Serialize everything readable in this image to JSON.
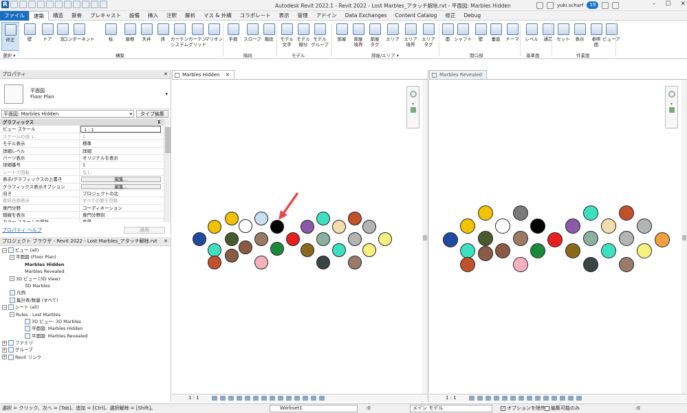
{
  "app": {
    "title": "Autodesk Revit 2022.1 - Revit 2022 - Lost Marbles_アタッチ解除.rvt - 平面図: Marbles Hidden",
    "user": "yuki.scharf",
    "notifications": "19",
    "window_controls": [
      "–",
      "☐",
      "✕"
    ]
  },
  "ribbon_tabs": [
    {
      "label": "ファイル",
      "kind": "file"
    },
    {
      "label": "建築",
      "kind": "active"
    },
    {
      "label": "構造"
    },
    {
      "label": "鉄骨"
    },
    {
      "label": "プレキャスト"
    },
    {
      "label": "設備"
    },
    {
      "label": "挿入"
    },
    {
      "label": "注釈"
    },
    {
      "label": "解析"
    },
    {
      "label": "マス & 外構"
    },
    {
      "label": "コラボレート"
    },
    {
      "label": "表示"
    },
    {
      "label": "管理"
    },
    {
      "label": "アドイン"
    },
    {
      "label": "Data Exchanges"
    },
    {
      "label": "Content Catalog"
    },
    {
      "label": "修正"
    },
    {
      "label": "Debug"
    }
  ],
  "ribbon_tools": [
    {
      "label": "修正",
      "icon": "cursor-icon",
      "selected": true
    },
    {
      "label": "壁",
      "icon": "wall-icon"
    },
    {
      "label": "ドア",
      "icon": "door-icon"
    },
    {
      "label": "窓",
      "icon": "window-icon"
    },
    {
      "label": "コンポーネント",
      "icon": "component-icon"
    },
    {
      "label": "柱",
      "icon": "column-icon"
    },
    {
      "label": "屋根",
      "icon": "roof-icon"
    },
    {
      "label": "天井",
      "icon": "ceiling-icon"
    },
    {
      "label": "床",
      "icon": "floor-icon"
    },
    {
      "label": "カーテン\nシステム",
      "icon": "curtain-system-icon"
    },
    {
      "label": "カーテン\nグリッド",
      "icon": "curtain-grid-icon"
    },
    {
      "label": "マリオン",
      "icon": "mullion-icon"
    },
    {
      "label": "手摺",
      "icon": "railing-icon"
    },
    {
      "label": "スロープ",
      "icon": "ramp-icon"
    },
    {
      "label": "階段",
      "icon": "stair-icon"
    },
    {
      "label": "モデル\n文字",
      "icon": "model-text-icon"
    },
    {
      "label": "モデル\n線分",
      "icon": "model-line-icon"
    },
    {
      "label": "モデル\nグループ",
      "icon": "model-group-icon"
    },
    {
      "label": "部屋",
      "icon": "room-icon"
    },
    {
      "label": "部屋\n境界",
      "icon": "room-separator-icon"
    },
    {
      "label": "部屋\nタグ",
      "icon": "room-tag-icon"
    },
    {
      "label": "エリア",
      "icon": "area-icon"
    },
    {
      "label": "エリア\n境界",
      "icon": "area-boundary-icon"
    },
    {
      "label": "エリア\nタグ",
      "icon": "area-tag-icon"
    },
    {
      "label": "面",
      "icon": "by-face-icon"
    },
    {
      "label": "シャフト",
      "icon": "shaft-icon"
    },
    {
      "label": "壁",
      "icon": "wall-opening-icon"
    },
    {
      "label": "垂直",
      "icon": "vertical-icon"
    },
    {
      "label": "ドーマ",
      "icon": "dormer-icon"
    },
    {
      "label": "レベル",
      "icon": "level-icon"
    },
    {
      "label": "通芯",
      "icon": "grid-icon"
    },
    {
      "label": "セット",
      "icon": "set-icon"
    },
    {
      "label": "表示",
      "icon": "show-icon"
    },
    {
      "label": "参照\n面",
      "icon": "ref-plane-icon"
    },
    {
      "label": "ビューア",
      "icon": "viewer-icon"
    }
  ],
  "ribbon_panels": [
    "選択 ▾",
    "構築",
    "階段",
    "モデル",
    "部屋/エリア ▾",
    "開口部",
    "基準面",
    "作業面"
  ],
  "properties": {
    "title": "プロパティ",
    "type_name": "平面図",
    "type_sub": "Floor Plan",
    "view_selector": "平面図: Marbles Hidden",
    "edit_type": "タイプ編集",
    "rows": [
      {
        "k": "グラフィックス",
        "v": "",
        "group": true
      },
      {
        "k": "ビュー スケール",
        "v": "1 : 1",
        "box": true
      },
      {
        "k": "スケールの値   1:",
        "v": "1",
        "gray": true
      },
      {
        "k": "モデル表示",
        "v": "標準"
      },
      {
        "k": "詳細レベル",
        "v": "詳細"
      },
      {
        "k": "パーツ表示",
        "v": "オリジナルを表示"
      },
      {
        "k": "詳細番号",
        "v": "1"
      },
      {
        "k": "シートで回転",
        "v": "なし",
        "gray": true
      },
      {
        "k": "表示/グラフィックスの上書き",
        "v": "編集...",
        "btn": true
      },
      {
        "k": "グラフィックス表示オプション",
        "v": "編集...",
        "btn": true
      },
      {
        "k": "向き",
        "v": "プロジェクトの北"
      },
      {
        "k": "壁結合部表示",
        "v": "すべての壁を包絡",
        "gray": true
      },
      {
        "k": "専門分野",
        "v": "コーディネーション"
      },
      {
        "k": "隠線を表示",
        "v": "専門分野別"
      },
      {
        "k": "カラー スキームの場所",
        "v": "背景"
      }
    ],
    "help_link": "プロパティ ヘルプ",
    "apply": "適用"
  },
  "browser": {
    "title": "プロジェクト ブラウザ - Revit 2022 - Lost Marbles_アタッチ解除.rvt",
    "nodes": [
      {
        "label": "ビュー (all)",
        "indent": 0,
        "ex": "−",
        "icon": true
      },
      {
        "label": "平面図 (Floor Plan)",
        "indent": 1,
        "ex": "−"
      },
      {
        "label": "Marbles Hidden",
        "indent": 2,
        "bold": true
      },
      {
        "label": "Marbles Revealed",
        "indent": 2
      },
      {
        "label": "3D ビュー (3D View)",
        "indent": 1,
        "ex": "−"
      },
      {
        "label": "3D Marbles",
        "indent": 2
      },
      {
        "label": "凡例",
        "indent": 0,
        "icon": true
      },
      {
        "label": "集計表/数量 (すべて)",
        "indent": 0,
        "icon": true
      },
      {
        "label": "シート (all)",
        "indent": 0,
        "ex": "−",
        "icon": true
      },
      {
        "label": "Rules - Lost Marbles",
        "indent": 1,
        "ex": "−"
      },
      {
        "label": "3D ビュー: 3D Marbles",
        "indent": 2,
        "icon": true
      },
      {
        "label": "平面図: Marbles Hidden",
        "indent": 2,
        "icon": true
      },
      {
        "label": "平面図: Marbles Revealed",
        "indent": 2,
        "icon": true
      },
      {
        "label": "ファミリ",
        "indent": 0,
        "ex": "+",
        "icon": true
      },
      {
        "label": "グループ",
        "indent": 0,
        "ex": "+",
        "icon": true
      },
      {
        "label": "Revit リンク",
        "indent": 0,
        "ex": "+",
        "icon": true
      }
    ]
  },
  "views": [
    {
      "tab": "Marbles Hidden",
      "close": "✕",
      "scale": "1 : 1"
    },
    {
      "tab": "Marbles Revealed",
      "scale": "1 : 1"
    }
  ],
  "marble_colors": {
    "navy": "#1f4aa0",
    "yellow": "#f2c200",
    "teal": "#3ee0c0",
    "rust": "#c0512a",
    "white": "#ffffff",
    "darkgreen": "#4a5a2e",
    "brown": "#8a5a44",
    "lightblue": "#c9def2",
    "gray": "#7a7a7a",
    "taupe": "#9a7a64",
    "pink": "#f6b2c0",
    "black": "#000000",
    "green": "#1a8a3a",
    "red": "#e62020",
    "purple": "#8a5aa8",
    "sage": "#8ab0a0",
    "tan": "#f2dcb0",
    "charcoal": "#3a4442",
    "lightgray": "#b4b4b4",
    "olive": "#8a6a1a",
    "lemon": "#f6f280",
    "orange": "#f2a040",
    "mauve": "#9a7a68"
  },
  "status": {
    "message": "選択 = クリック、次へ = [Tab]、追加 = [Ctrl]、選択解除 = [Shift]。",
    "workset": "Workset1",
    "zero1": ":0",
    "model": "メイン モデル",
    "option_exclude": "オプションを除外",
    "editable_only": "編集可能のみ",
    "zero2": ":0"
  }
}
